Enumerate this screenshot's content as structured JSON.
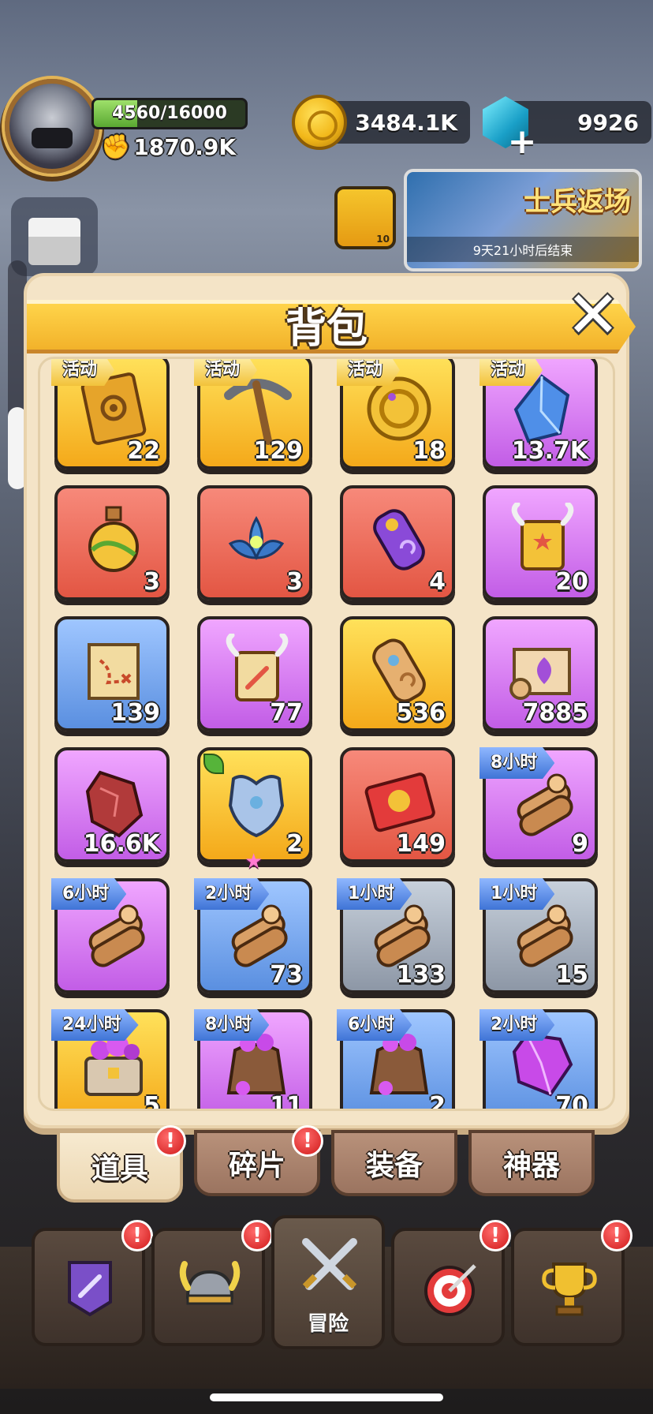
{
  "hud": {
    "xp_text": "4560/16000",
    "xp_progress": 0.285,
    "power": "1870.9K",
    "coins": "3484.1K",
    "gems": "9926"
  },
  "event": {
    "title": "士兵返场",
    "countdown": "9天21小时后结束",
    "scroll_count": "10"
  },
  "backpack": {
    "title": "背包",
    "items": [
      {
        "bg": "gold",
        "icon": "tablet-icon",
        "tag": "活动",
        "tag_type": "activity",
        "count": "22"
      },
      {
        "bg": "gold",
        "icon": "pickaxe-icon",
        "tag": "活动",
        "tag_type": "activity",
        "count": "129"
      },
      {
        "bg": "gold",
        "icon": "event-coin-icon",
        "tag": "活动",
        "tag_type": "activity",
        "count": "18"
      },
      {
        "bg": "purple",
        "icon": "blue-crystal-icon",
        "tag": "活动",
        "tag_type": "activity",
        "count": "13.7K"
      },
      {
        "bg": "red",
        "icon": "potion-icon",
        "tag": "",
        "tag_type": "",
        "count": "3"
      },
      {
        "bg": "red",
        "icon": "lotus-icon",
        "tag": "",
        "tag_type": "",
        "count": "3"
      },
      {
        "bg": "red",
        "icon": "purple-scroll-icon",
        "tag": "",
        "tag_type": "",
        "count": "4"
      },
      {
        "bg": "purple",
        "icon": "horned-scroll-icon",
        "tag": "",
        "tag_type": "",
        "count": "20"
      },
      {
        "bg": "blue",
        "icon": "map-icon",
        "tag": "",
        "tag_type": "",
        "count": "139"
      },
      {
        "bg": "purple",
        "icon": "sword-scroll-icon",
        "tag": "",
        "tag_type": "",
        "count": "77"
      },
      {
        "bg": "gold",
        "icon": "rolled-scroll-icon",
        "tag": "",
        "tag_type": "",
        "count": "536"
      },
      {
        "bg": "purple",
        "icon": "rune-scroll-icon",
        "tag": "",
        "tag_type": "",
        "count": "7885"
      },
      {
        "bg": "purple",
        "icon": "ore-icon",
        "tag": "",
        "tag_type": "",
        "count": "16.6K"
      },
      {
        "bg": "gold",
        "icon": "armor-icon",
        "tag": "",
        "tag_type": "",
        "count": "2",
        "leaf": true,
        "star": true
      },
      {
        "bg": "red",
        "icon": "card-icon",
        "tag": "",
        "tag_type": "",
        "count": "149"
      },
      {
        "bg": "purple",
        "icon": "wood-icon",
        "tag": "8小时",
        "tag_type": "time",
        "count": "9"
      },
      {
        "bg": "purple",
        "icon": "wood-icon",
        "tag": "6小时",
        "tag_type": "time",
        "count": ""
      },
      {
        "bg": "blue",
        "icon": "wood-icon",
        "tag": "2小时",
        "tag_type": "time",
        "count": "73"
      },
      {
        "bg": "grey",
        "icon": "wood-icon",
        "tag": "1小时",
        "tag_type": "time",
        "count": "133"
      },
      {
        "bg": "grey",
        "icon": "wood-icon",
        "tag": "1小时",
        "tag_type": "time",
        "count": "15"
      },
      {
        "bg": "gold",
        "icon": "gem-chest-icon",
        "tag": "24小时",
        "tag_type": "time",
        "count": "5"
      },
      {
        "bg": "purple",
        "icon": "gem-sack-icon",
        "tag": "8小时",
        "tag_type": "time",
        "count": "11"
      },
      {
        "bg": "blue",
        "icon": "gem-sack-icon",
        "tag": "6小时",
        "tag_type": "time",
        "count": "2"
      },
      {
        "bg": "blue",
        "icon": "purple-gem-icon",
        "tag": "2小时",
        "tag_type": "time",
        "count": "70"
      }
    ]
  },
  "tabs": [
    {
      "label": "道具",
      "active": true,
      "badge": "!"
    },
    {
      "label": "碎片",
      "active": false,
      "badge": "!"
    },
    {
      "label": "装备",
      "active": false,
      "badge": ""
    },
    {
      "label": "神器",
      "active": false,
      "badge": ""
    }
  ],
  "nav": {
    "adventure_label": "冒险",
    "badge": "!"
  },
  "colors": {
    "gold": "#f4a91a",
    "purple": "#c25de6",
    "red": "#e35643",
    "blue": "#5a8fe0",
    "grey": "#8d97a6",
    "panel": "#f4e4c7",
    "title_bar": "#f2b22a"
  }
}
